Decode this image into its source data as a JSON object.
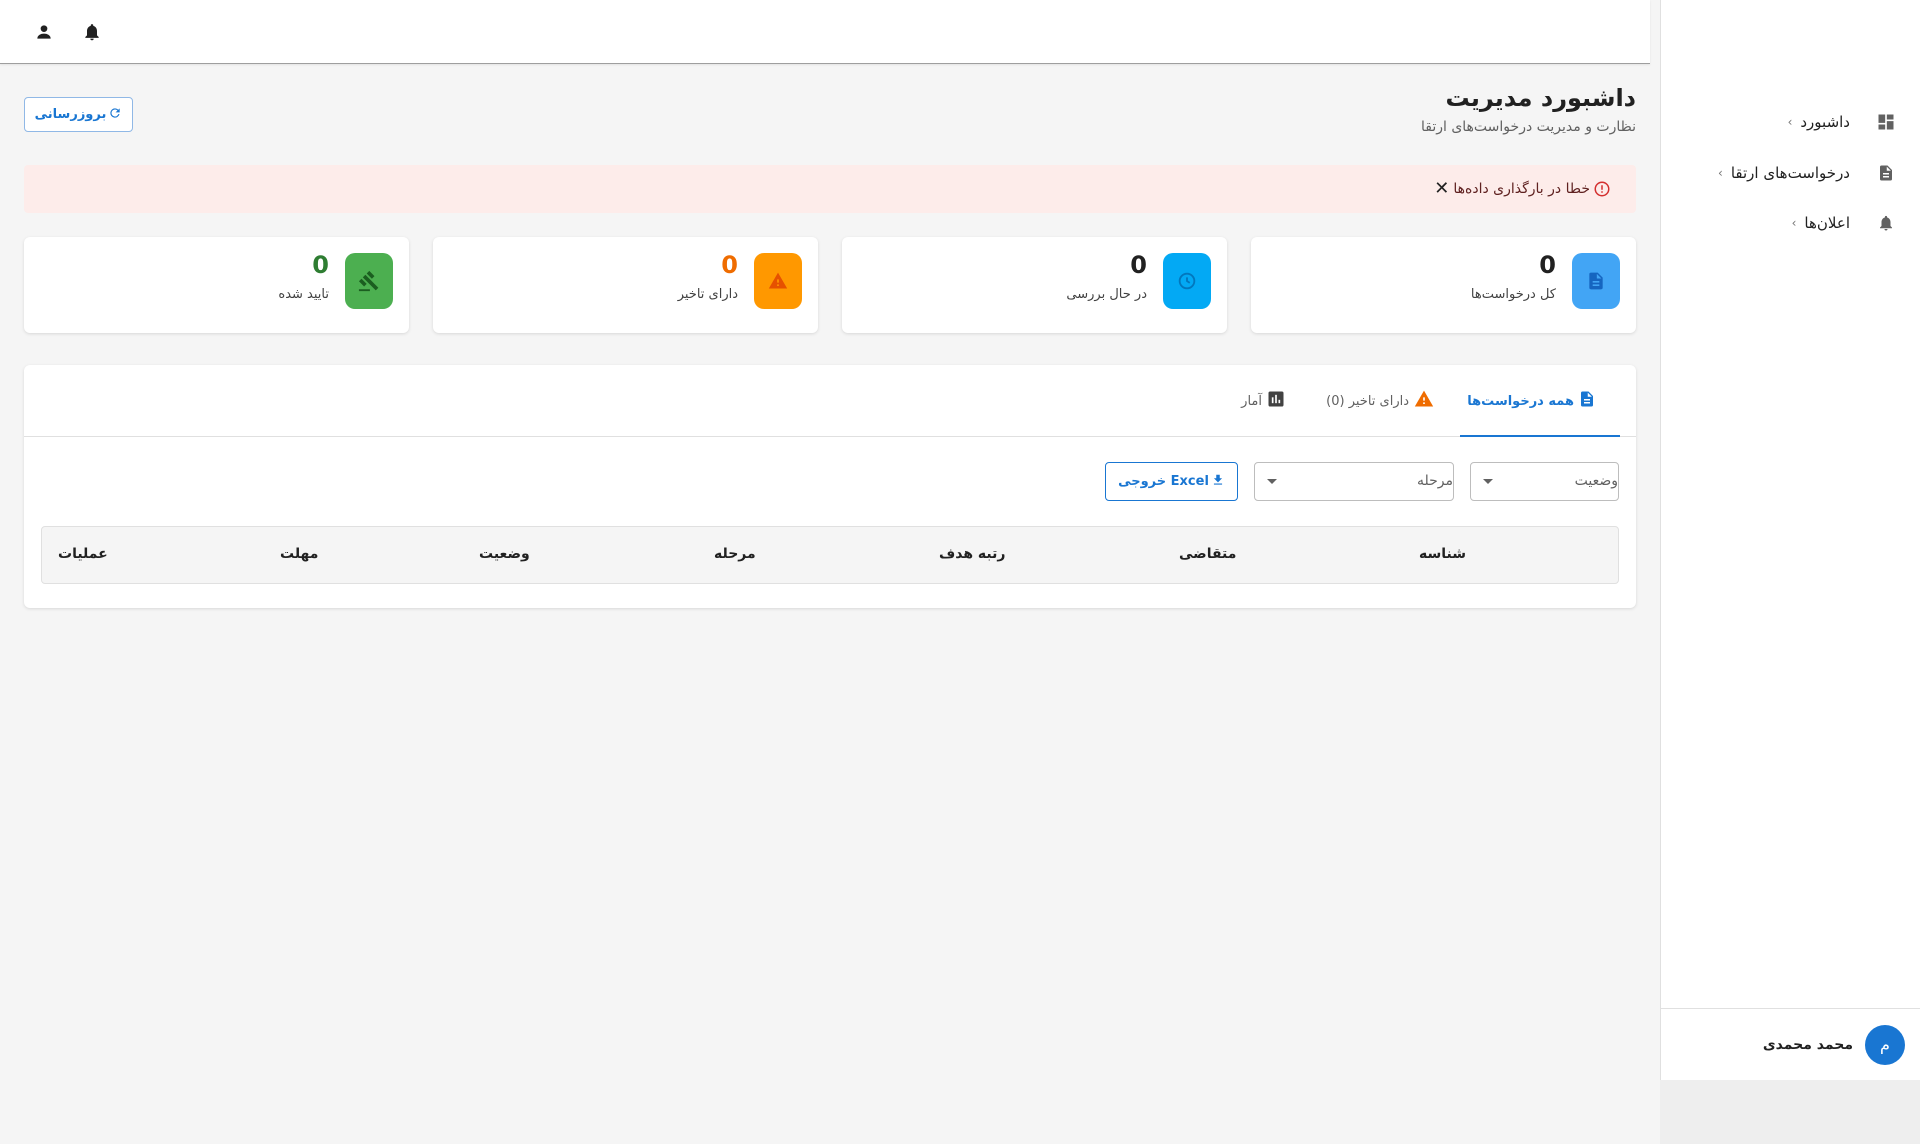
{
  "topbar": {
    "icons": [
      "account-icon",
      "notification-bell-icon"
    ]
  },
  "sidebar": {
    "items": [
      {
        "label": "داشبورد",
        "icon": "dashboard-icon"
      },
      {
        "label": "درخواست‌های ارتقا",
        "icon": "document-icon"
      },
      {
        "label": "اعلان‌ها",
        "icon": "bell-icon"
      }
    ],
    "user": {
      "avatar_letter": "م",
      "name": "محمد محمدی"
    }
  },
  "header": {
    "title": "داشبورد مدیریت",
    "subtitle": "نظارت و مدیریت درخواست‌های ارتقا",
    "refresh_label": "بروزرسانی"
  },
  "alert": {
    "text": "خطا در بارگذاری داده‌ها",
    "color": "#d32f2f"
  },
  "stats": [
    {
      "label": "کل درخواست‌ها",
      "value": "0",
      "icon": "document-icon",
      "color": "#42a5f5",
      "value_color": "#212121"
    },
    {
      "label": "در حال بررسی",
      "value": "0",
      "icon": "clock-icon",
      "color": "#03a9f4",
      "value_color": "#212121"
    },
    {
      "label": "دارای تاخیر",
      "value": "0",
      "icon": "warning-icon",
      "color": "#ff9800",
      "value_color": "#ef6c00"
    },
    {
      "label": "تایید شده",
      "value": "0",
      "icon": "gavel-icon",
      "color": "#4caf50",
      "value_color": "#2e7d32"
    }
  ],
  "tabs": [
    {
      "label": "همه درخواست‌ها",
      "icon": "document-icon",
      "active": true
    },
    {
      "label": "دارای تاخیر (0)",
      "icon": "warning-icon",
      "active": false
    },
    {
      "label": "آمار",
      "icon": "bar-chart-icon",
      "active": false
    }
  ],
  "filters": {
    "status_label": "وضعیت",
    "stage_label": "مرحله",
    "export_label": "خروجی Excel"
  },
  "table": {
    "columns": [
      "شناسه",
      "متقاضی",
      "رتبه هدف",
      "مرحله",
      "وضعیت",
      "مهلت",
      "عملیات"
    ]
  },
  "colors": {
    "primary": "#1976d2",
    "alert_bg": "#fdecea"
  }
}
